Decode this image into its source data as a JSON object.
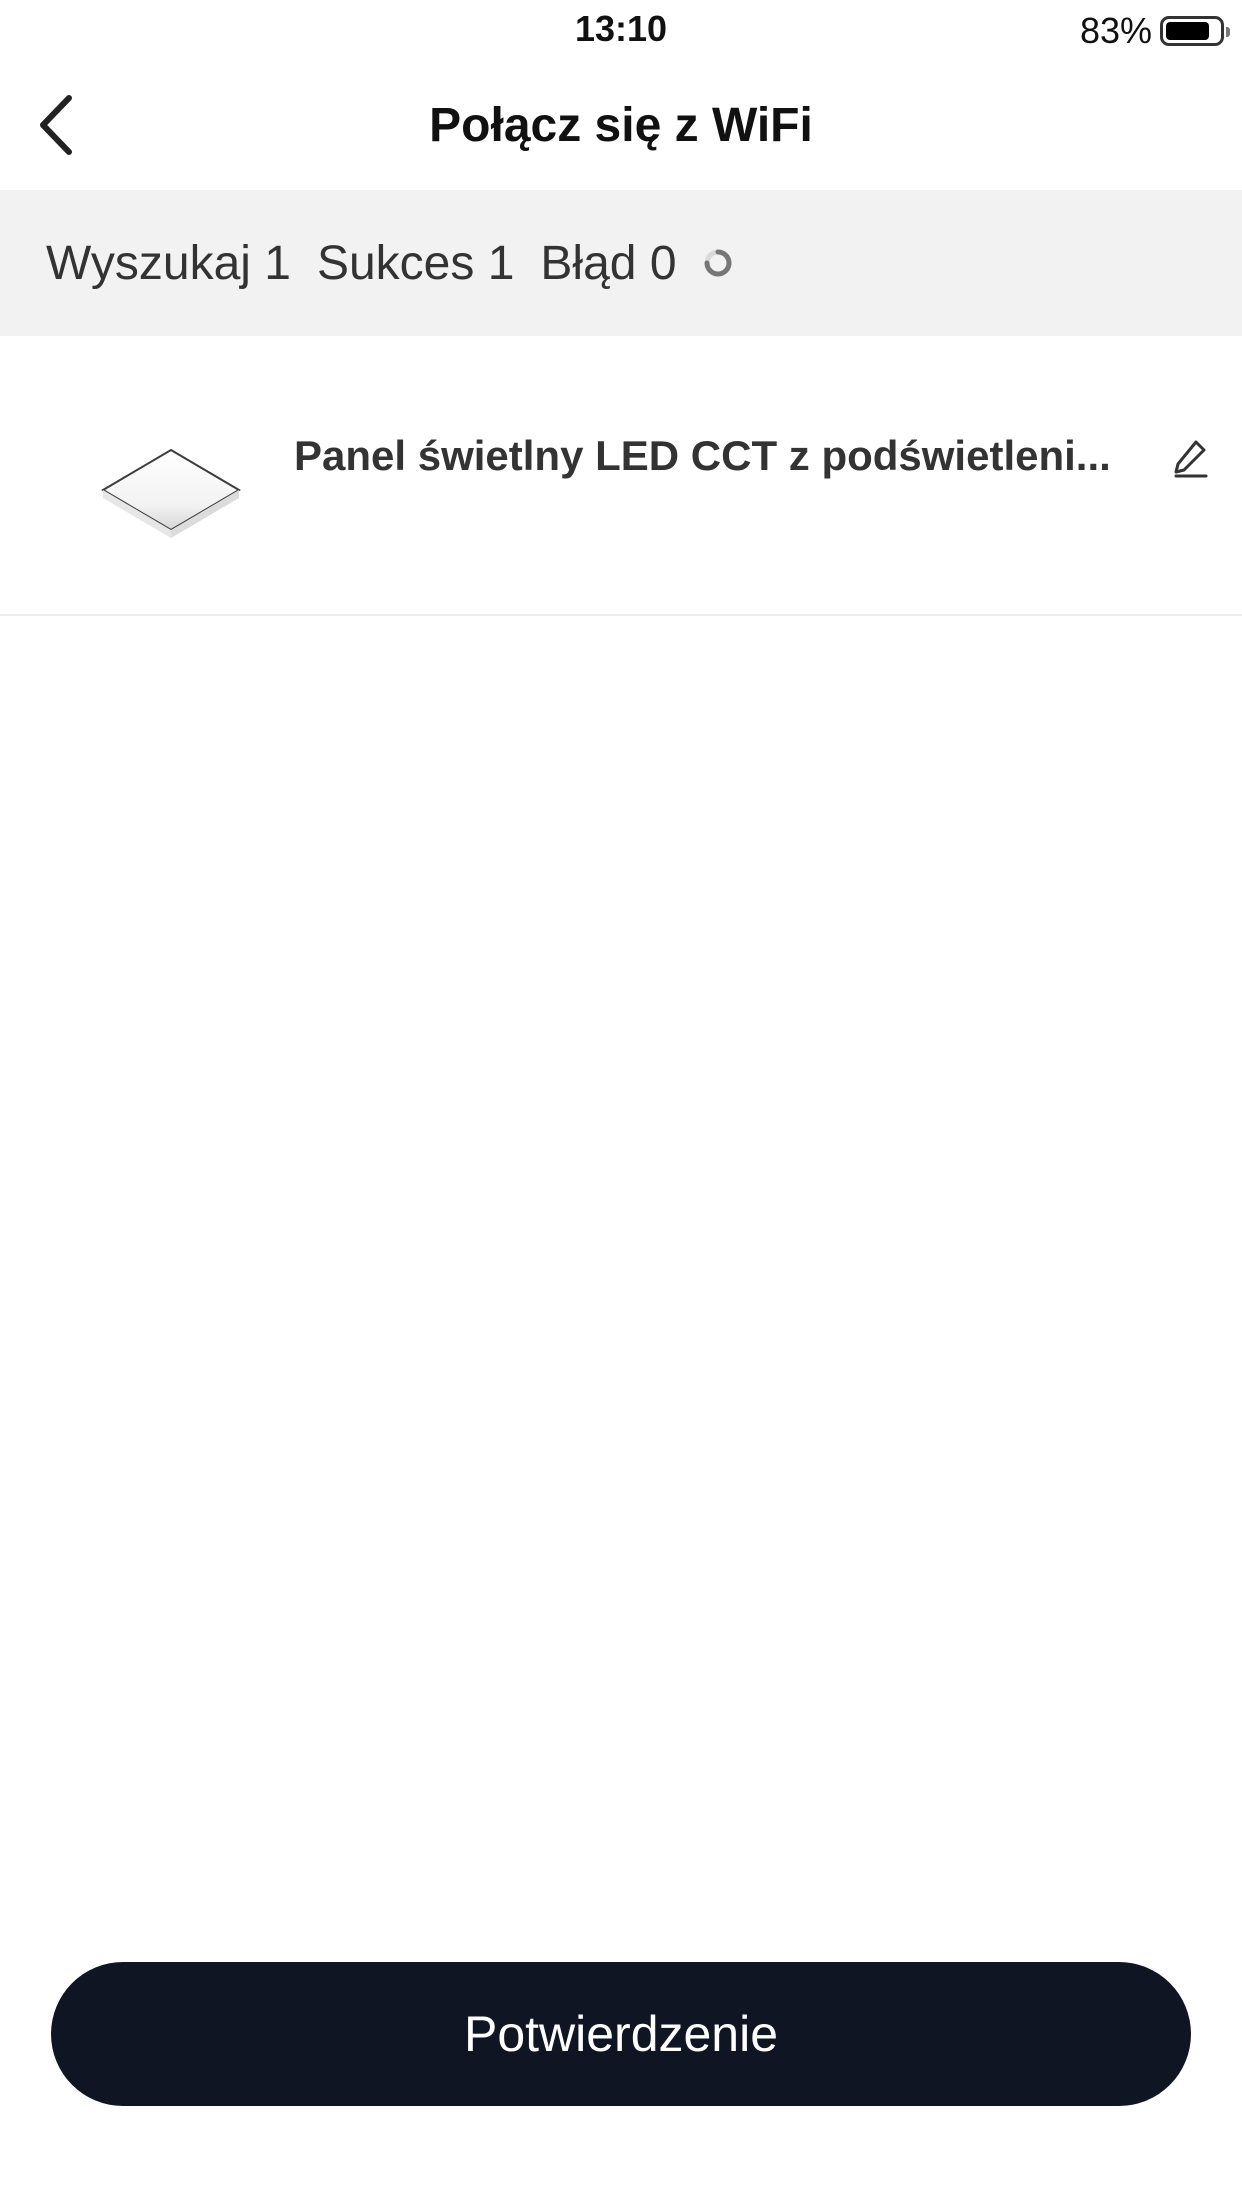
{
  "status_bar": {
    "time": "13:10",
    "battery_percent": "83%",
    "battery_level": 0.83
  },
  "nav": {
    "title": "Połącz się z WiFi",
    "back_icon": "chevron-left-icon"
  },
  "progress": {
    "search_label": "Wyszukaj 1",
    "success_label": "Sukces 1",
    "error_label": "Błąd 0",
    "spinner_icon": "loading-spinner-icon"
  },
  "devices": [
    {
      "name": "Panel świetlny LED CCT z podświetleni...",
      "image_icon": "led-panel-icon",
      "edit_icon": "pencil-icon"
    }
  ],
  "confirm_button": {
    "label": "Potwierdzenie",
    "color": "#0f1523"
  }
}
